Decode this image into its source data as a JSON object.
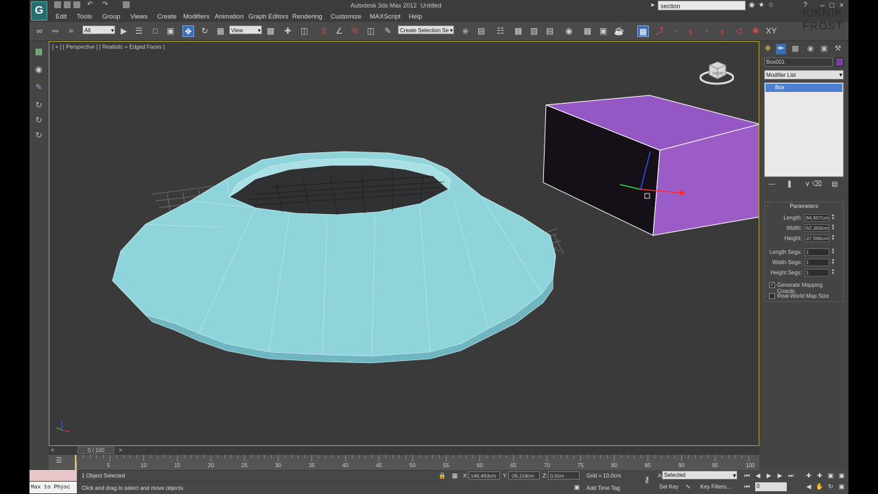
{
  "window": {
    "title": "Autodesk 3ds Max 2012",
    "document": "Untitled",
    "search": "section"
  },
  "menu": [
    "Edit",
    "Tools",
    "Group",
    "Views",
    "Create",
    "Modifiers",
    "Animation",
    "Graph Editors",
    "Rendering",
    "Customize",
    "MAXScript",
    "Help"
  ],
  "toolbar": {
    "filter": "All",
    "ref_coord": "View",
    "selection_set": "Create Selection Se"
  },
  "viewport": {
    "label": "[ + ] [ Perspective ] [ Realistic + Edged Faces ]",
    "cube_label": "FRONT"
  },
  "timeline": {
    "frame_label": "0 / 100",
    "ticks": [
      "5",
      "10",
      "15",
      "20",
      "25",
      "30",
      "35",
      "40",
      "45",
      "50",
      "55",
      "60",
      "65",
      "70",
      "75",
      "80",
      "85",
      "90",
      "95",
      "100"
    ]
  },
  "command_panel": {
    "object_name": "Box001",
    "object_color": "#7b3fa8",
    "modifier_list": "Modifier List",
    "stack_item": "Box",
    "params_title": "Parameters",
    "params": [
      {
        "label": "Length:",
        "value": "84,607cm"
      },
      {
        "label": "Width:",
        "value": "62,363cm"
      },
      {
        "label": "Height:",
        "value": "37,596cm"
      },
      {
        "label": "Length Segs:",
        "value": "1"
      },
      {
        "label": "Width Segs:",
        "value": "1"
      },
      {
        "label": "Height Segs:",
        "value": "1"
      }
    ],
    "gen_mapping": "Generate Mapping Coords.",
    "real_world": "Real-World Map Size"
  },
  "status": {
    "maxscript": "Max to Physc",
    "line1": "1 Object Selected",
    "line2": "Click and drag to select and move objects",
    "x_label": "X:",
    "x": "146,493cm",
    "y_label": "Y:",
    "y": "-26,118cm",
    "z_label": "Z:",
    "z": "0,0cm",
    "grid": "Grid = 10,0cm",
    "add_time_tag": "Add Time Tag",
    "auto_key": "Auto Key",
    "selected": "Selected",
    "set_key": "Set Key",
    "key_filters": "Key Filters...",
    "frame": "0"
  },
  "watermark": {
    "line1": "KIKNIK",
    "line2": "FROST"
  }
}
